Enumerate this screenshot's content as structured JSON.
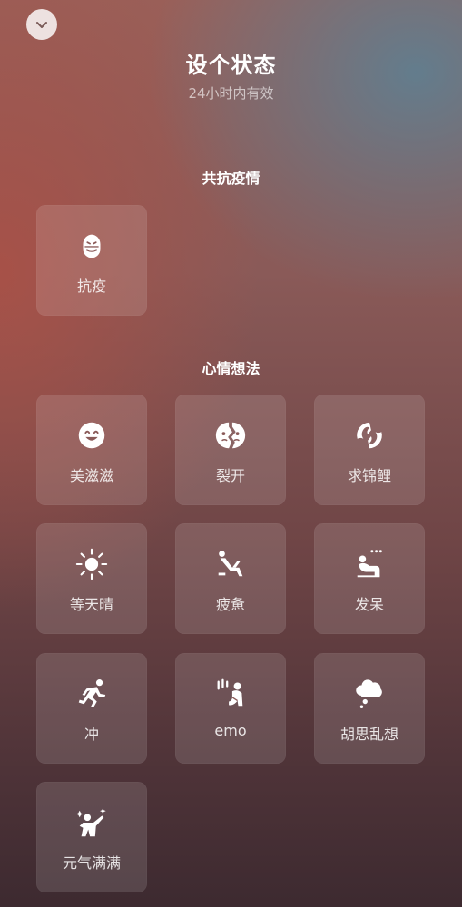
{
  "header": {
    "title": "设个状态",
    "subtitle": "24小时内有效"
  },
  "sections": [
    {
      "title": "共抗疫情",
      "items": [
        {
          "label": "抗疫",
          "icon": "mask-face-icon"
        }
      ]
    },
    {
      "title": "心情想法",
      "items": [
        {
          "label": "美滋滋",
          "icon": "smile-face-icon"
        },
        {
          "label": "裂开",
          "icon": "cracked-face-icon"
        },
        {
          "label": "求锦鲤",
          "icon": "koi-fish-icon"
        },
        {
          "label": "等天晴",
          "icon": "sun-icon"
        },
        {
          "label": "疲惫",
          "icon": "tired-person-icon"
        },
        {
          "label": "发呆",
          "icon": "daze-person-icon"
        },
        {
          "label": "冲",
          "icon": "running-person-icon"
        },
        {
          "label": "emo",
          "icon": "sad-person-icon"
        },
        {
          "label": "胡思乱想",
          "icon": "thought-cloud-icon"
        },
        {
          "label": "元气满满",
          "icon": "energetic-person-icon"
        }
      ]
    }
  ]
}
